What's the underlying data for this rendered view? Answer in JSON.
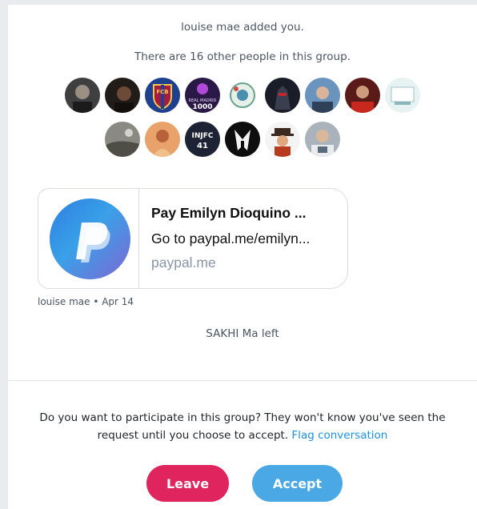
{
  "messages": {
    "added": "louise mae added you.",
    "count": "There are 16 other people in this group.",
    "left": "SAKHI Ma left"
  },
  "avatars": {
    "row1": [
      {
        "name": "member-1",
        "color": "#4b4b4b"
      },
      {
        "name": "member-2",
        "color": "#2a2522"
      },
      {
        "name": "member-3",
        "color": "#1f3f8f"
      },
      {
        "name": "member-4",
        "color": "#3b1f5e"
      },
      {
        "name": "member-5",
        "color": "#dfe8e4"
      },
      {
        "name": "member-6",
        "color": "#1c1f2a"
      },
      {
        "name": "member-7",
        "color": "#5a83b0"
      },
      {
        "name": "member-8",
        "color": "#8c2a25"
      },
      {
        "name": "member-9",
        "color": "#dfeef0"
      }
    ],
    "row2": [
      {
        "name": "member-10",
        "color": "#7a7a72"
      },
      {
        "name": "member-11",
        "color": "#c97a4a"
      },
      {
        "name": "member-12",
        "color": "#1e2235"
      },
      {
        "name": "member-13",
        "color": "#0e0e0e"
      },
      {
        "name": "member-14",
        "color": "#f4f4f4"
      },
      {
        "name": "member-15",
        "color": "#9aa3ad"
      }
    ],
    "badge_text": {
      "fcb": "FCB",
      "real_madrid": "REAL MADRID",
      "real_madrid_num": "1000",
      "injfc": "INJFC",
      "injfc_num": "41"
    }
  },
  "link_card": {
    "title": "Pay Emilyn Dioquino ...",
    "description": "Go to paypal.me/emilyn...",
    "domain": "paypal.me"
  },
  "meta": {
    "author": "louise mae",
    "separator": " • ",
    "date": "Apr 14"
  },
  "request": {
    "prompt_line1": "Do you want to participate in this group? They won't know you've seen the",
    "prompt_line2": "request until you choose to accept.",
    "flag_link": "Flag conversation",
    "leave_label": "Leave",
    "accept_label": "Accept"
  },
  "colors": {
    "leave": "#e0245e",
    "accept": "#4aa8e4",
    "link": "#1d8fe0"
  }
}
